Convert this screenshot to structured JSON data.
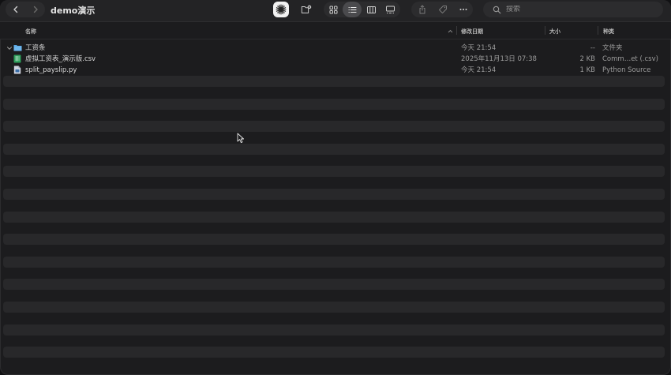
{
  "window": {
    "title": "demo演示"
  },
  "toolbar": {
    "back_icon": "chevron-left-icon",
    "forward_icon": "chevron-right-icon",
    "views": [
      "icon-view-icon",
      "list-view-icon",
      "column-view-icon",
      "gallery-view-icon"
    ],
    "active_view": "list-view-icon",
    "actions": [
      "share-icon",
      "tag-icon",
      "more-icon"
    ]
  },
  "search": {
    "placeholder": "搜索"
  },
  "columns": {
    "name": "名称",
    "date": "修改日期",
    "size": "大小",
    "kind": "种类"
  },
  "files": [
    {
      "name": "工资条",
      "date": "今天 21:54",
      "size": "--",
      "kind": "文件夹",
      "icon": "folder-icon",
      "expandable": true
    },
    {
      "name": "虚拟工资表_演示版.csv",
      "date": "2025年11月13日 07:38",
      "size": "2 KB",
      "kind": "Comm…et (.csv)",
      "icon": "spreadsheet-file-icon",
      "expandable": false
    },
    {
      "name": "split_payslip.py",
      "date": "今天 21:54",
      "size": "1 KB",
      "kind": "Python Source",
      "icon": "python-file-icon",
      "expandable": false
    }
  ],
  "colors": {
    "folder": "#5aa9e6",
    "csv": "#2e9e5b",
    "python": "#d0d4e0",
    "stripe": "#28282a"
  }
}
